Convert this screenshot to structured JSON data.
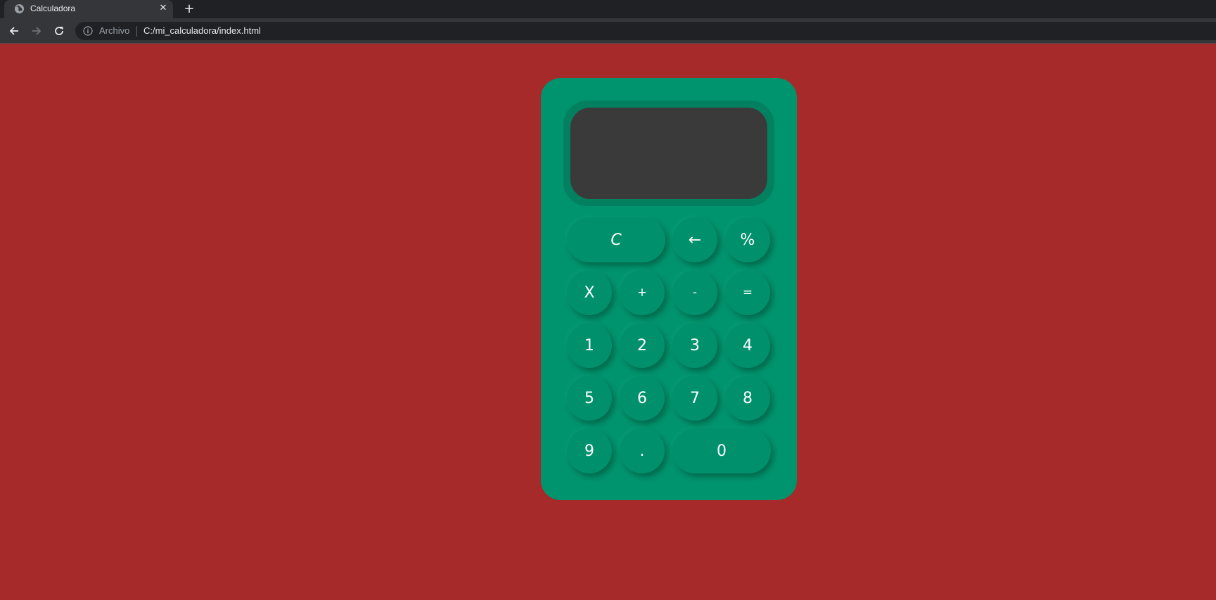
{
  "browser": {
    "tab_title": "Calculadora",
    "tab_close": "✕",
    "new_tab": "+",
    "scheme_label": "Archivo",
    "url": "C:/mi_calculadora/index.html"
  },
  "calculator": {
    "display_value": "",
    "keys": {
      "clear": "C",
      "backspace": "←",
      "percent": "%",
      "multiply": "X",
      "add": "+",
      "subtract": "-",
      "equals": "=",
      "one": "1",
      "two": "2",
      "three": "3",
      "four": "4",
      "five": "5",
      "six": "6",
      "seven": "7",
      "eight": "8",
      "nine": "9",
      "decimal": ".",
      "zero": "0"
    }
  },
  "colors": {
    "page_background": "#a62a2a",
    "calculator_body": "#00946e",
    "display_background": "#3a3a3a"
  }
}
